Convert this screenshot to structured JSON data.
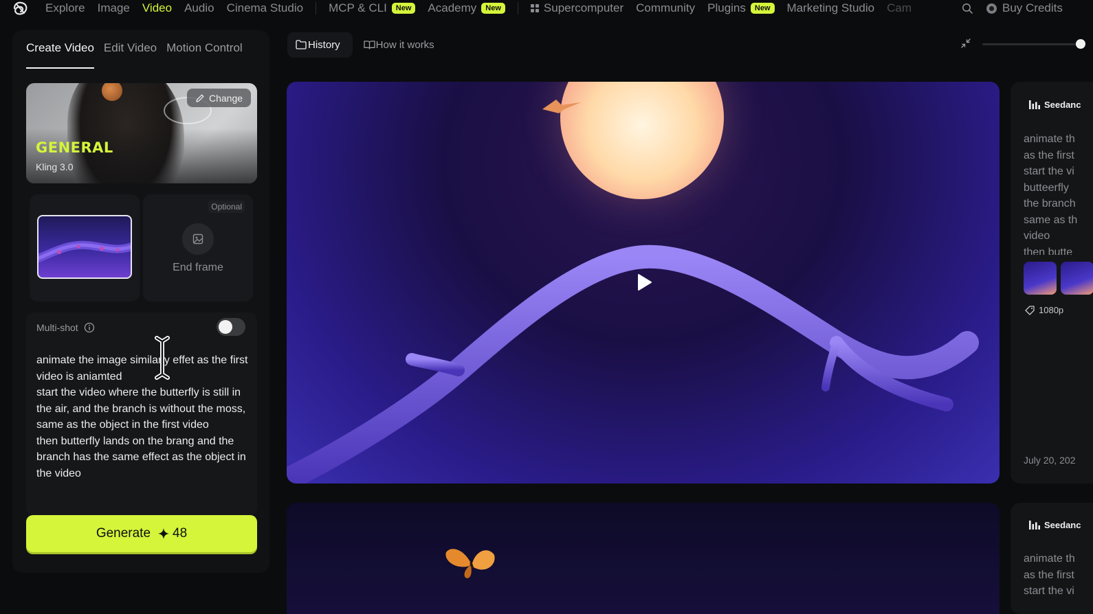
{
  "nav": {
    "items": [
      {
        "label": "Explore",
        "badge": "",
        "active": false
      },
      {
        "label": "Image",
        "badge": "",
        "active": false
      },
      {
        "label": "Video",
        "badge": "",
        "active": true
      },
      {
        "label": "Audio",
        "badge": "",
        "active": false
      },
      {
        "label": "Cinema Studio",
        "badge": "",
        "active": false
      },
      {
        "label": "MCP & CLI",
        "badge": "New",
        "active": false
      },
      {
        "label": "Academy",
        "badge": "New",
        "active": false
      },
      {
        "label": "Supercomputer",
        "badge": "",
        "active": false
      },
      {
        "label": "Community",
        "badge": "",
        "active": false
      },
      {
        "label": "Plugins",
        "badge": "New",
        "active": false
      },
      {
        "label": "Marketing Studio",
        "badge": "",
        "active": false
      },
      {
        "label": "Cam",
        "badge": "",
        "active": false
      }
    ],
    "buy_credits": "Buy Credits",
    "accent": "#d4f53a"
  },
  "left": {
    "tabs": [
      "Create Video",
      "Edit Video",
      "Motion Control"
    ],
    "model_card": {
      "title": "GENERAL",
      "model": "Kling 3.0",
      "change_label": "Change"
    },
    "end_frame": {
      "optional": "Optional",
      "label": "End frame"
    },
    "multishot": {
      "label": "Multi-shot",
      "enabled": false
    },
    "prompt": "animate the image similarly effet as the first video is aniamted\nstart the video where the butterfly is still in the air, and the branch is without the moss, same as the object in the first video\nthen butterfly lands on the brang and the branch has the same effect as the object in the video",
    "generate": {
      "label": "Generate",
      "cost": "48"
    }
  },
  "center": {
    "tabs": [
      "History",
      "How it works"
    ],
    "zoom_level": 1.0
  },
  "right": {
    "model": "Seedanc",
    "prompt_preview": "animate th\nas the first\nstart the vi\nbutteerfly\nthe branch\nsame as th\nvideo\nthen butte",
    "resolution": "1080p",
    "date": "July 20, 202",
    "second_prompt_preview": "animate th\nas the first\nstart the vi"
  }
}
